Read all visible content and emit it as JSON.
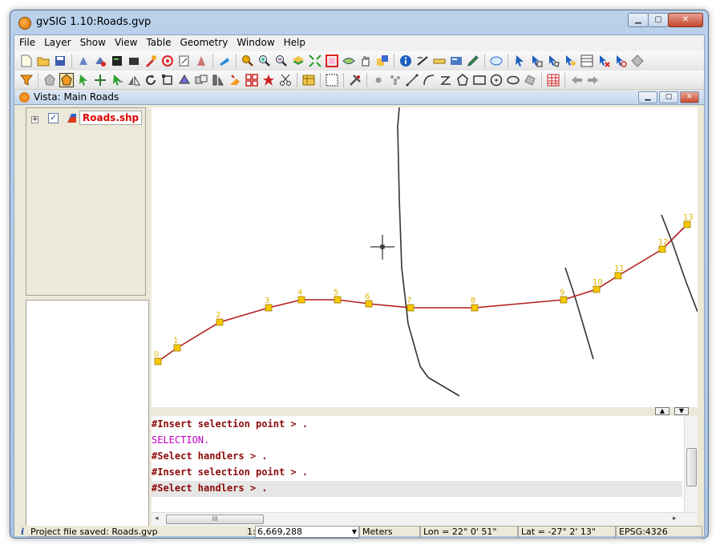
{
  "window": {
    "title": "gvSIG 1.10:Roads.gvp",
    "minimize": "▁",
    "maximize": "▢",
    "close": "✕"
  },
  "menu": [
    "File",
    "Layer",
    "Show",
    "View",
    "Table",
    "Geometry",
    "Window",
    "Help"
  ],
  "view": {
    "title": "Vista: Main Roads"
  },
  "toc": {
    "layer_name": "Roads.shp",
    "expand": "+",
    "check": "✓"
  },
  "map": {
    "vertex_labels": [
      "0",
      "1",
      "2",
      "3",
      "4",
      "5",
      "6",
      "7",
      "8",
      "9",
      "10",
      "11",
      "12",
      "13"
    ]
  },
  "console": {
    "lines": [
      {
        "text": "#Insert selection point > .",
        "type": "cmd"
      },
      {
        "text": "SELECTION.",
        "type": "sel"
      },
      {
        "text": "#Select handlers > .",
        "type": "cmd"
      },
      {
        "text": "#Insert selection point > .",
        "type": "cmd"
      },
      {
        "text": "#Select handlers > .",
        "type": "cmd-active"
      }
    ],
    "scroll_up": "▲",
    "scroll_down": "▼",
    "hscroll_grip": "III"
  },
  "status": {
    "message_icon": "i",
    "message": "Project file saved: Roads.gvp",
    "scale_prefix": "1:",
    "scale_value": "6,669,288",
    "units": "Meters",
    "lon": "Lon = 22° 0' 51\"",
    "lat": "Lat = -27° 2' 13\"",
    "epsg": "EPSG:4326"
  },
  "colors": {
    "polyline": "#b21e1e",
    "vertex": "#f7c700",
    "road": "#333333",
    "label": "#e3b400"
  }
}
